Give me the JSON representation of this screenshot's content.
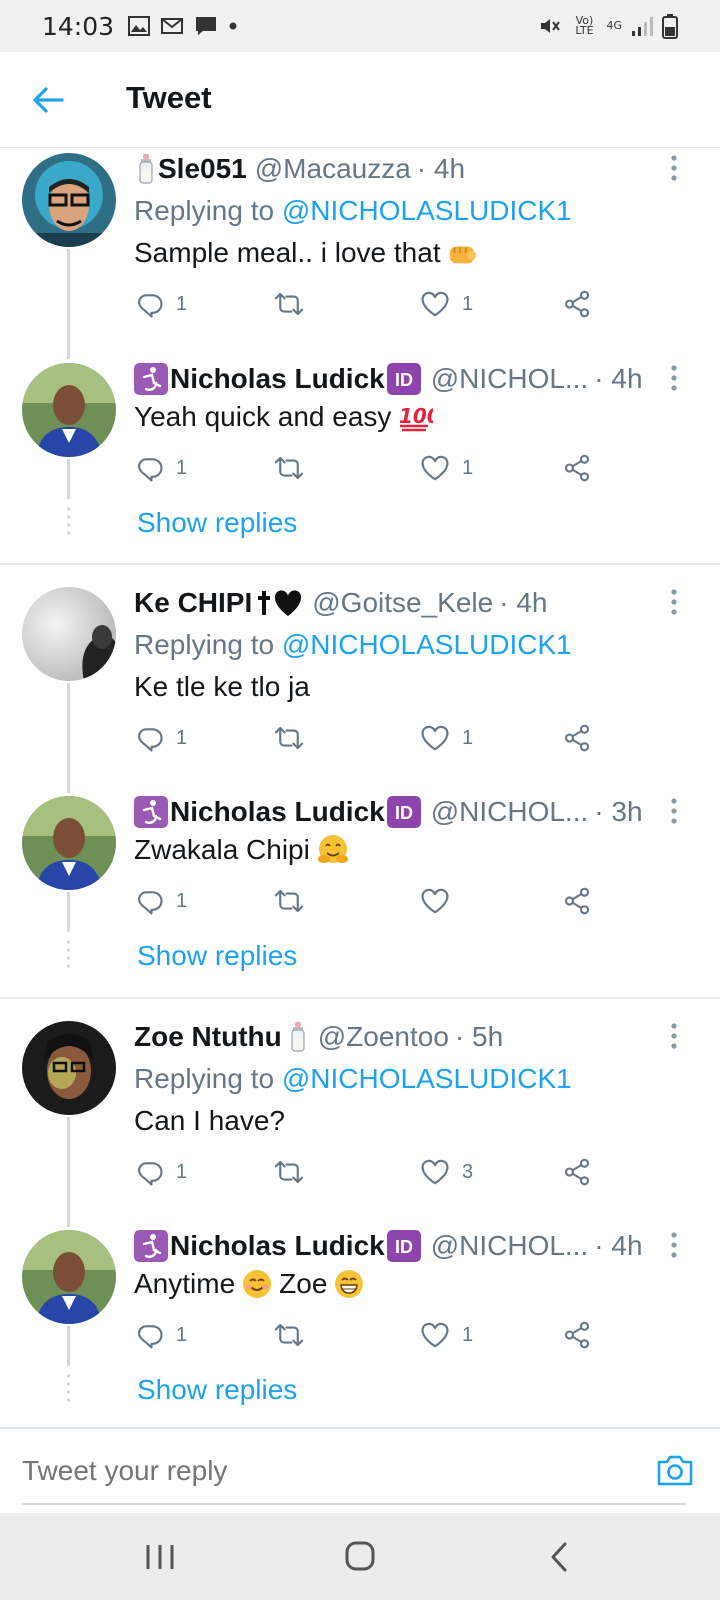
{
  "status_bar": {
    "time": "14:03",
    "network": "4G",
    "volte": "Vo) LTE"
  },
  "header": {
    "title": "Tweet"
  },
  "tweets": [
    {
      "name": "Sle051",
      "handle": "@Macauzza",
      "time": "· 4h",
      "replying_prefix": "Replying to",
      "replying_to": "@NICHOLASLUDICK1",
      "text": "Sample meal.. i love that",
      "reply_count": "1",
      "like_count": "1"
    },
    {
      "name": "Nicholas Ludick",
      "handle": "@NICHOL...",
      "time": "· 4h",
      "text": "Yeah quick and easy",
      "reply_count": "1",
      "like_count": "1",
      "show_replies": "Show replies"
    },
    {
      "name": "Ke CHIPI",
      "handle": "@Goitse_Kele",
      "time": "· 4h",
      "replying_prefix": "Replying to",
      "replying_to": "@NICHOLASLUDICK1",
      "text": "Ke tle ke tlo ja",
      "reply_count": "1",
      "like_count": "1"
    },
    {
      "name": "Nicholas Ludick",
      "handle": "@NICHOL...",
      "time": "· 3h",
      "text": "Zwakala Chipi",
      "reply_count": "1",
      "like_count": "",
      "show_replies": "Show replies"
    },
    {
      "name": "Zoe Ntuthu",
      "handle": "@Zoentoo",
      "time": "· 5h",
      "replying_prefix": "Replying to",
      "replying_to": "@NICHOLASLUDICK1",
      "text": "Can I have?",
      "reply_count": "1",
      "like_count": "3"
    },
    {
      "name": "Nicholas Ludick",
      "handle": "@NICHOL...",
      "time": "· 4h",
      "text_a": "Anytime",
      "text_b": "Zoe",
      "reply_count": "1",
      "like_count": "1",
      "show_replies": "Show replies"
    }
  ],
  "reply_bar": {
    "placeholder": "Tweet your reply"
  },
  "colors": {
    "accent": "#1da1f2",
    "secondary_text": "#657786",
    "primary_text": "#14171a"
  }
}
